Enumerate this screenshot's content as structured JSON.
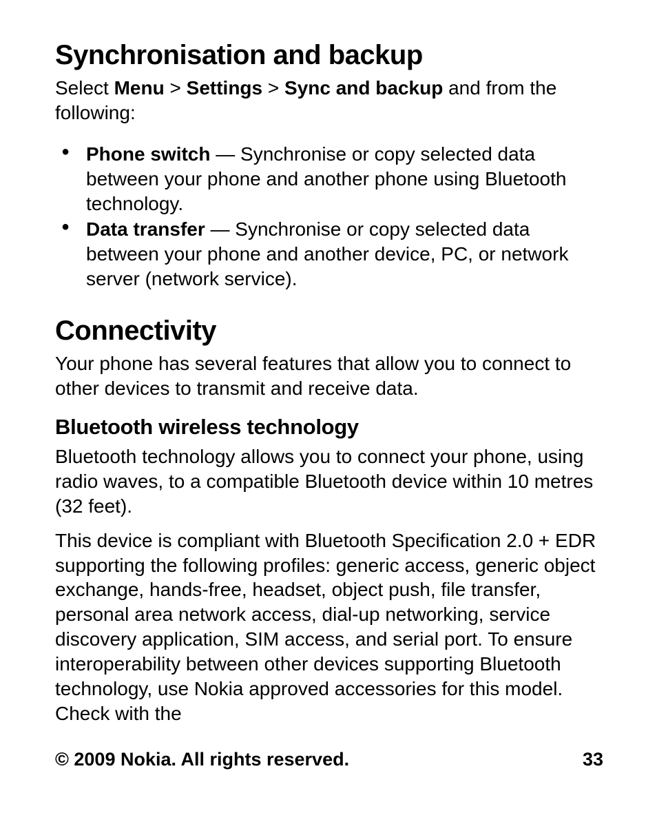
{
  "section1": {
    "heading": "Synchronisation and backup",
    "intro_prefix": "Select ",
    "nav1": "Menu",
    "nav_sep": " > ",
    "nav2": "Settings",
    "nav3": "Sync and backup",
    "intro_suffix": " and from the following:",
    "items": [
      {
        "label": "Phone switch",
        "desc": " — Synchronise or copy selected data between your phone and another phone using Bluetooth technology."
      },
      {
        "label": "Data transfer",
        "desc": " — Synchronise or copy selected data between your phone and another device, PC, or network server (network service)."
      }
    ]
  },
  "section2": {
    "heading": "Connectivity",
    "intro": "Your phone has several features that allow you to connect to other devices to transmit and receive data.",
    "sub_heading": "Bluetooth wireless technology",
    "para1": "Bluetooth technology allows you to connect your phone, using radio waves, to a compatible Bluetooth device within 10 metres (32 feet).",
    "para2": "This device is compliant with Bluetooth Specification 2.0 + EDR supporting the following profiles: generic access, generic object exchange, hands-free, headset, object push, file transfer, personal area network access, dial-up networking, service discovery application, SIM access, and serial port. To ensure interoperability between other devices supporting Bluetooth technology, use Nokia approved accessories for this model. Check with the"
  },
  "footer": {
    "copyright": "© 2009 Nokia. All rights reserved.",
    "page": "33"
  }
}
